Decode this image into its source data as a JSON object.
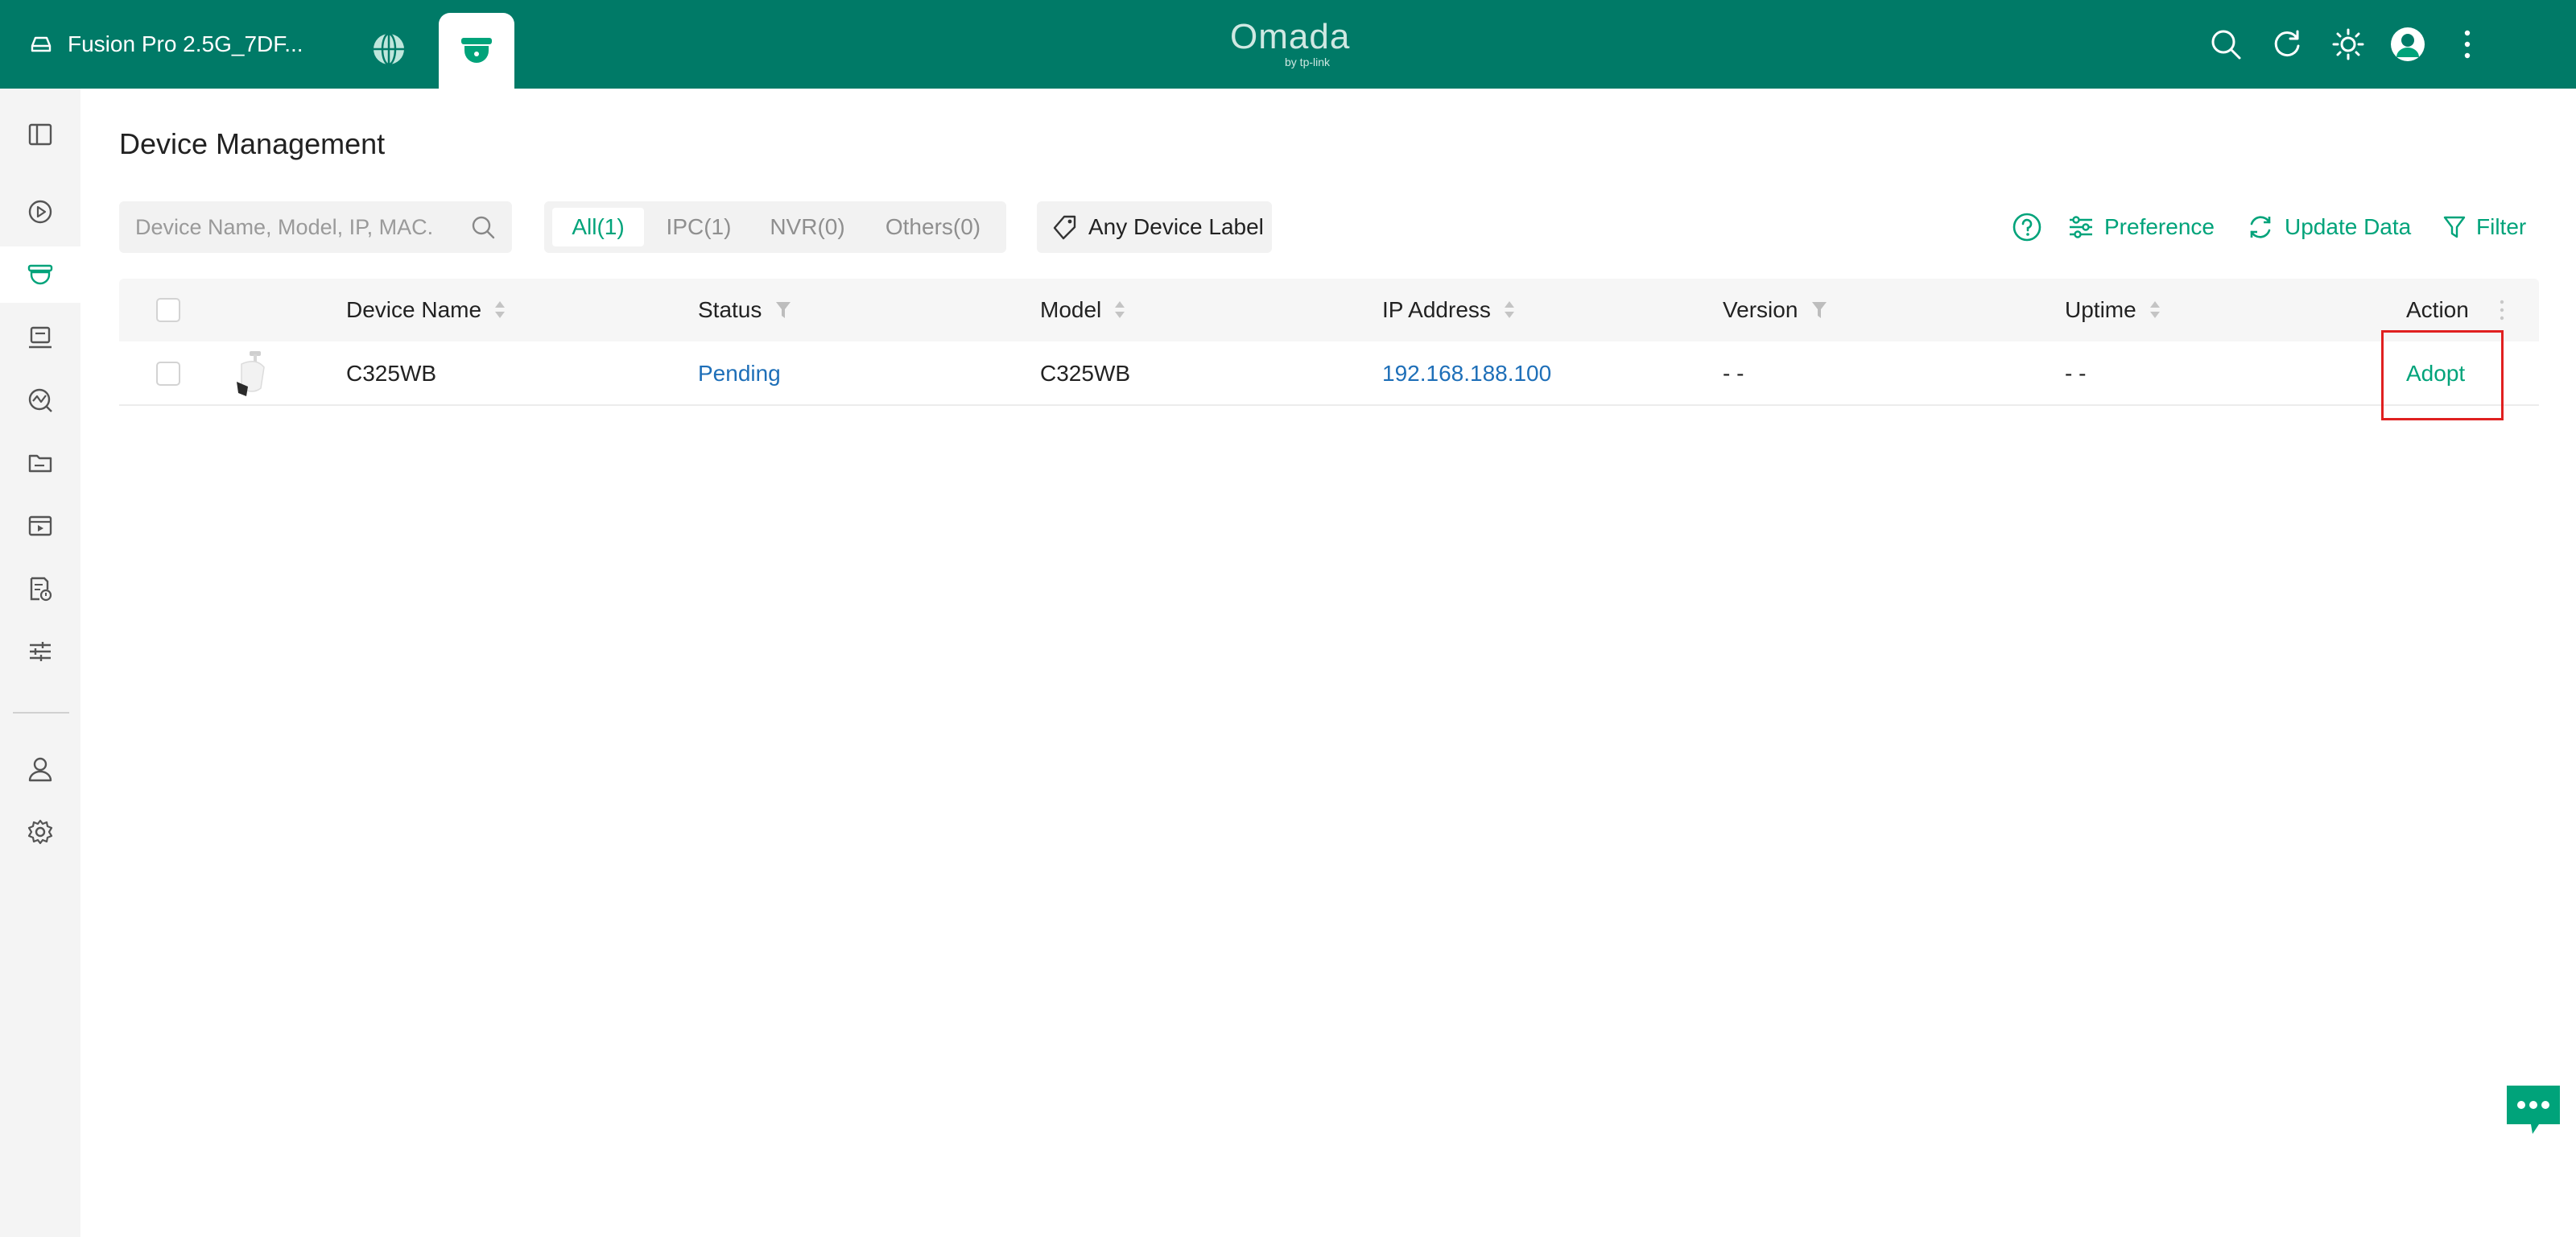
{
  "header": {
    "device_name": "Fusion Pro 2.5G_7DF...",
    "logo": "Omada",
    "logo_sub": "by tp-link"
  },
  "page": {
    "title": "Device Management"
  },
  "search": {
    "placeholder": "Device Name, Model, IP, MAC."
  },
  "filters": {
    "tabs": [
      {
        "label": "All(1)",
        "active": true
      },
      {
        "label": "IPC(1)",
        "active": false
      },
      {
        "label": "NVR(0)",
        "active": false
      },
      {
        "label": "Others(0)",
        "active": false
      }
    ],
    "device_label": "Any Device Label"
  },
  "toolbar": {
    "preference": "Preference",
    "update_data": "Update Data",
    "filter": "Filter"
  },
  "table": {
    "columns": {
      "device_name": "Device Name",
      "status": "Status",
      "model": "Model",
      "ip": "IP Address",
      "version": "Version",
      "uptime": "Uptime",
      "action": "Action"
    },
    "rows": [
      {
        "device_name": "C325WB",
        "status": "Pending",
        "model": "C325WB",
        "ip": "192.168.188.100",
        "version": "- -",
        "uptime": "- -",
        "action": "Adopt"
      }
    ]
  },
  "colors": {
    "brand": "#007a67",
    "accent": "#00a37a",
    "link": "#1e6fb8",
    "highlight": "#e02020"
  },
  "icons": {
    "sidebar": [
      "sidebar-toggle-icon",
      "playback-icon",
      "camera-icon",
      "device-list-icon",
      "insight-icon",
      "folder-icon",
      "video-wall-icon",
      "log-icon",
      "settings-sliders-icon",
      "user-icon",
      "gear-icon"
    ],
    "top": [
      "search-icon",
      "refresh-icon",
      "theme-icon",
      "avatar",
      "more-icon"
    ]
  }
}
